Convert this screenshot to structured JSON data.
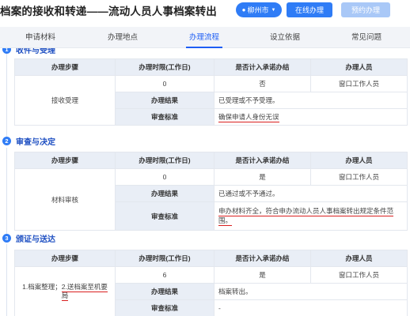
{
  "header": {
    "title": "档案的接收和转递——流动人员人事档案转出",
    "city": "柳州市",
    "online_button": "在线办理",
    "appointment_button": "预约办理"
  },
  "tabs": [
    {
      "label": "申请材料"
    },
    {
      "label": "办理地点"
    },
    {
      "label": "办理流程"
    },
    {
      "label": "设立依据"
    },
    {
      "label": "常见问题"
    }
  ],
  "sections": [
    {
      "number": "1",
      "title": "收件与受理",
      "columns": [
        "办理步骤",
        "办理时限(工作日)",
        "是否计入承诺办结",
        "办理人员"
      ],
      "step_name": "接收受理",
      "time_limit": "0",
      "counts_to_promise": "否",
      "staff": "窗口工作人员",
      "result_label": "办理结果",
      "result_value": "已受理或不予受理。",
      "standard_label": "审查标准",
      "standard_value": "确保申请人身份无误"
    },
    {
      "number": "2",
      "title": "审查与决定",
      "columns": [
        "办理步骤",
        "办理时限(工作日)",
        "是否计入承诺办结",
        "办理人员"
      ],
      "step_name": "材料审核",
      "time_limit": "0",
      "counts_to_promise": "是",
      "staff": "窗口工作人员",
      "result_label": "办理结果",
      "result_value": "已通过或不予通过。",
      "standard_label": "审查标准",
      "standard_value": "申办材料齐全，符合申办流动人员人事档案转出规定条件范围。"
    },
    {
      "number": "3",
      "title": "颁证与送达",
      "columns": [
        "办理步骤",
        "办理时限(工作日)",
        "是否计入承诺办结",
        "办理人员"
      ],
      "step_name_part1": "1.档案整理；",
      "step_name_part2": "2.送档案至机要局",
      "time_limit": "6",
      "counts_to_promise": "是",
      "staff": "窗口工作人员",
      "result_label": "办理结果",
      "result_value": "档案转出。",
      "standard_label": "审查标准",
      "standard_value": "-"
    }
  ]
}
